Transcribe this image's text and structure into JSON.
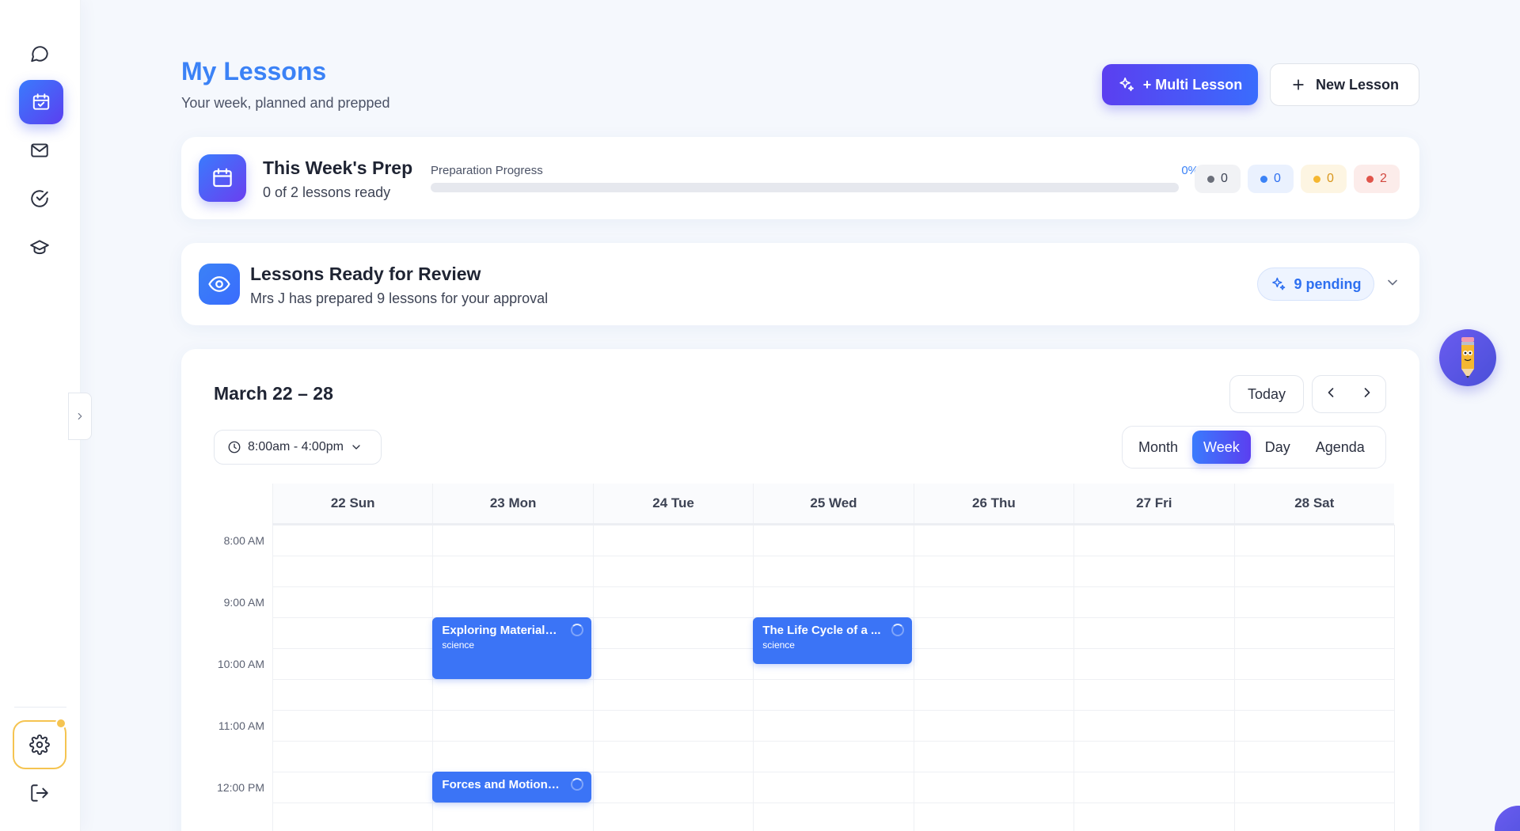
{
  "header": {
    "title": "My Lessons",
    "subtitle": "Your week, planned and prepped",
    "multi_lesson_label": "+ Multi Lesson",
    "new_lesson_label": "New Lesson"
  },
  "prep": {
    "title": "This Week's Prep",
    "subtitle": "0 of 2 lessons ready",
    "progress_label": "Preparation Progress",
    "progress_pct_text": "0%",
    "progress_fraction": 0,
    "stats": [
      {
        "value": "0",
        "color": "#6b6f7a",
        "bg": "#f1f2f5",
        "text": "#3d4354"
      },
      {
        "value": "0",
        "color": "#3b82f6",
        "bg": "#eaf1fe",
        "text": "#2d6ff0"
      },
      {
        "value": "0",
        "color": "#f5b731",
        "bg": "#fdf5e2",
        "text": "#d8961c"
      },
      {
        "value": "2",
        "color": "#e0544a",
        "bg": "#fcecea",
        "text": "#d2483f"
      }
    ]
  },
  "review": {
    "title": "Lessons Ready for Review",
    "subtitle": "Mrs J has prepared 9 lessons for your approval",
    "pending_label": "9 pending"
  },
  "calendar": {
    "range": "March 22 – 28",
    "today_label": "Today",
    "time_filter": "8:00am - 4:00pm",
    "views": [
      "Month",
      "Week",
      "Day",
      "Agenda"
    ],
    "active_view": "Week",
    "days": [
      "22 Sun",
      "23 Mon",
      "24 Tue",
      "25 Wed",
      "26 Thu",
      "27 Fri",
      "28 Sat"
    ],
    "times": [
      "8:00 AM",
      "9:00 AM",
      "10:00 AM",
      "11:00 AM",
      "12:00 PM"
    ],
    "events": [
      {
        "title": "Exploring Materials...",
        "subject": "science",
        "day": 1,
        "start_hour": 9.5,
        "end_hour": 10.5
      },
      {
        "title": "The Life Cycle of a ...",
        "subject": "science",
        "day": 3,
        "start_hour": 9.5,
        "end_hour": 10.25
      },
      {
        "title": "Forces and Motion:...",
        "subject": "",
        "day": 1,
        "start_hour": 12.0,
        "end_hour": 12.5
      }
    ]
  },
  "colors": {
    "accent": "#3b82f6",
    "gradient_start": "#3a7bfd",
    "gradient_end": "#5b3ff0",
    "event": "#3b74f6",
    "settings_ring": "#f5c451"
  },
  "icons": {
    "sidebar": [
      "chat-bubble-icon",
      "calendar-icon",
      "mail-icon",
      "check-circle-icon",
      "graduation-cap-icon"
    ],
    "bottom": [
      "gear-icon",
      "logout-icon"
    ]
  }
}
